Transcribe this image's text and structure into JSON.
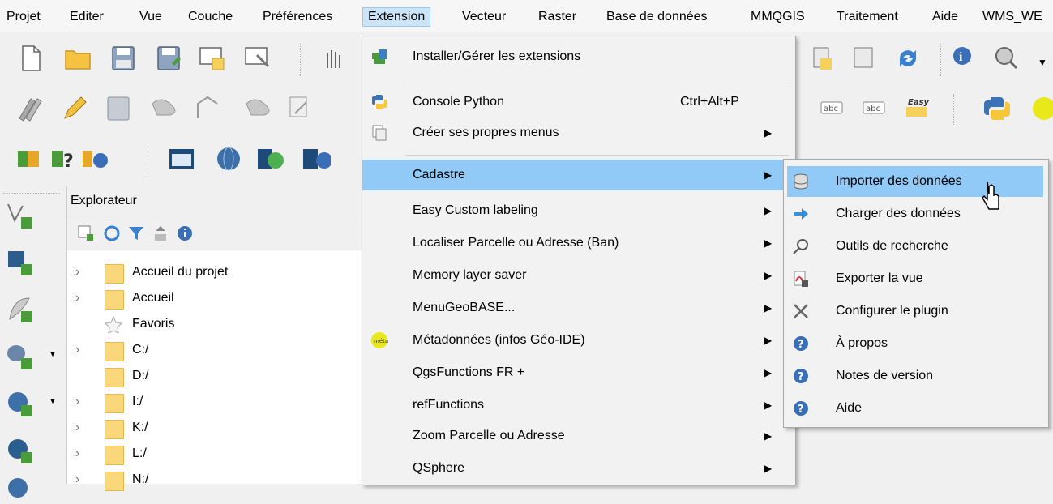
{
  "menubar": {
    "items": [
      "Projet",
      "Editer",
      "Vue",
      "Couche",
      "Préférences",
      "Extension",
      "Vecteur",
      "Raster",
      "Base de données",
      "MMQGIS",
      "Traitement",
      "Aide",
      "WMS_WE"
    ]
  },
  "explorer": {
    "title": "Explorateur",
    "items": [
      "Accueil du projet",
      "Accueil",
      "Favoris",
      "C:/",
      "D:/",
      "I:/",
      "K:/",
      "L:/",
      "N:/"
    ]
  },
  "extension_menu": {
    "items": [
      {
        "label": "Installer/Gérer les extensions",
        "shortcut": "",
        "submenu": false,
        "icon": "plugin-manager-icon"
      },
      {
        "label": "Console Python",
        "shortcut": "Ctrl+Alt+P",
        "submenu": false,
        "icon": "python-icon"
      },
      {
        "label": "Créer ses propres menus",
        "shortcut": "",
        "submenu": true,
        "icon": "custom-menu-icon"
      },
      {
        "label": "Cadastre",
        "shortcut": "",
        "submenu": true,
        "icon": ""
      },
      {
        "label": "Easy Custom labeling",
        "shortcut": "",
        "submenu": true,
        "icon": ""
      },
      {
        "label": "Localiser Parcelle ou Adresse (Ban)",
        "shortcut": "",
        "submenu": true,
        "icon": ""
      },
      {
        "label": "Memory layer saver",
        "shortcut": "",
        "submenu": true,
        "icon": ""
      },
      {
        "label": "MenuGeoBASE...",
        "shortcut": "",
        "submenu": true,
        "icon": ""
      },
      {
        "label": "Métadonnées (infos Géo-IDE)",
        "shortcut": "",
        "submenu": true,
        "icon": "metadata-icon"
      },
      {
        "label": "QgsFunctions FR +",
        "shortcut": "",
        "submenu": true,
        "icon": ""
      },
      {
        "label": "refFunctions",
        "shortcut": "",
        "submenu": true,
        "icon": ""
      },
      {
        "label": "Zoom Parcelle ou Adresse",
        "shortcut": "",
        "submenu": true,
        "icon": ""
      },
      {
        "label": "QSphere",
        "shortcut": "",
        "submenu": true,
        "icon": ""
      }
    ]
  },
  "cadastre_menu": {
    "items": [
      {
        "label": "Importer des données",
        "icon": "database-icon"
      },
      {
        "label": "Charger des données",
        "icon": "arrow-right-icon"
      },
      {
        "label": "Outils de recherche",
        "icon": "magnifier-icon"
      },
      {
        "label": "Exporter la vue",
        "icon": "pdf-export-icon"
      },
      {
        "label": "Configurer le plugin",
        "icon": "tools-icon"
      },
      {
        "label": "À propos",
        "icon": "help-icon"
      },
      {
        "label": "Notes de version",
        "icon": "help-icon"
      },
      {
        "label": "Aide",
        "icon": "help-icon"
      }
    ]
  },
  "colors": {
    "highlight": "#91c9f7",
    "menu_bg": "#f2f2f2",
    "active_menubar": "#cce4f7"
  }
}
